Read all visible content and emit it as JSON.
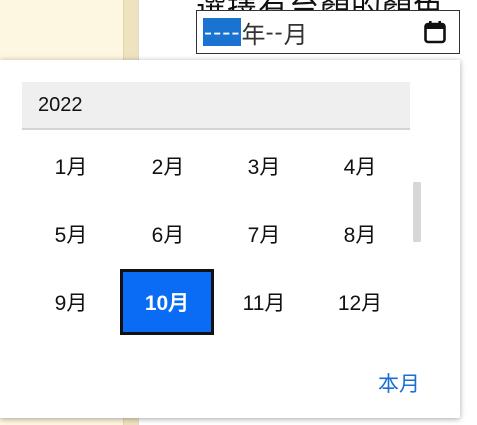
{
  "background": {
    "heading": "選擇有台顏的顏色"
  },
  "month_input": {
    "year_placeholder": "----",
    "year_unit": "年",
    "month_placeholder": "--",
    "month_unit": "月",
    "icon": "calendar-icon"
  },
  "picker": {
    "year": "2022",
    "months": [
      {
        "label": "1月"
      },
      {
        "label": "2月"
      },
      {
        "label": "3月"
      },
      {
        "label": "4月"
      },
      {
        "label": "5月"
      },
      {
        "label": "6月"
      },
      {
        "label": "7月"
      },
      {
        "label": "8月"
      },
      {
        "label": "9月"
      },
      {
        "label": "10月"
      },
      {
        "label": "11月"
      },
      {
        "label": "12月"
      }
    ],
    "selected_month": "10月",
    "this_month_label": "本月"
  },
  "colors": {
    "selected_bg": "#0a6cf5",
    "link": "#1a6fd0",
    "input_highlight": "#1a73d0"
  }
}
